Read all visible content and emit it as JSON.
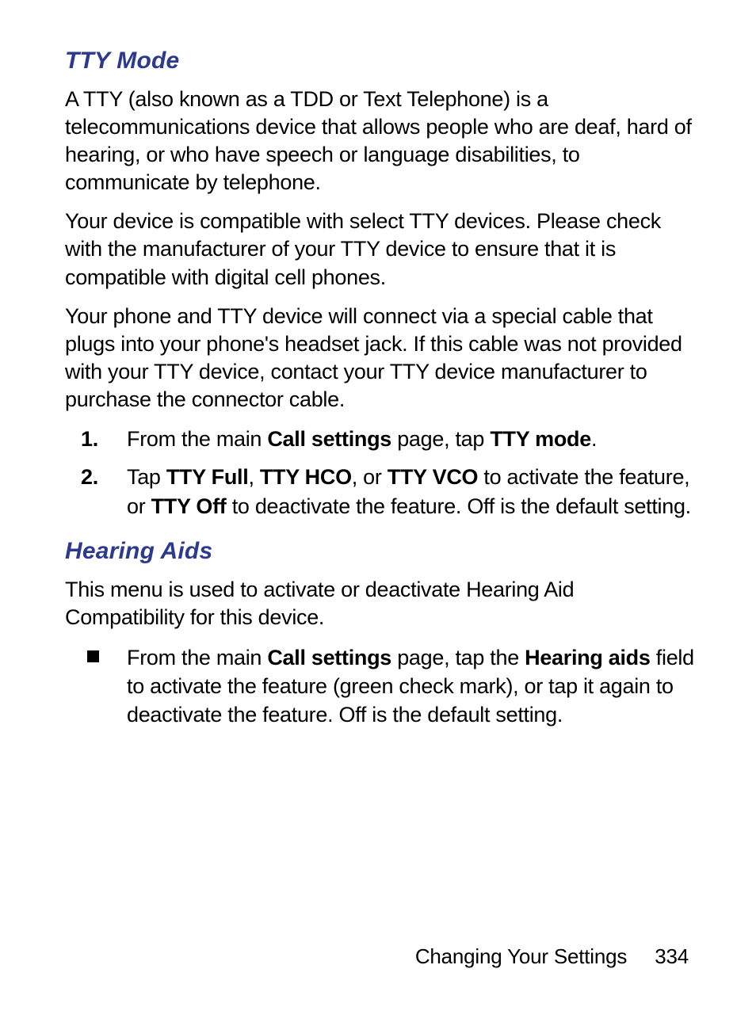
{
  "sections": [
    {
      "heading": "TTY Mode",
      "paragraphs": [
        "A TTY (also known as a TDD or Text Telephone) is a telecommunications device that allows people who are deaf, hard of hearing, or who have speech or language disabilities, to communicate by telephone.",
        "Your device is compatible with select TTY devices. Please check with the manufacturer of your TTY device to ensure that it is compatible with digital cell phones.",
        "Your phone and TTY device will connect via a special cable that plugs into your phone's headset jack. If this cable was not provided with your TTY device, contact your TTY device manufacturer to purchase the connector cable."
      ],
      "ordered_steps": [
        {
          "parts": [
            {
              "t": "From the main ",
              "b": false
            },
            {
              "t": "Call settings",
              "b": true
            },
            {
              "t": " page, tap ",
              "b": false
            },
            {
              "t": "TTY mode",
              "b": true
            },
            {
              "t": ".",
              "b": false
            }
          ]
        },
        {
          "parts": [
            {
              "t": "Tap ",
              "b": false
            },
            {
              "t": "TTY Full",
              "b": true
            },
            {
              "t": ", ",
              "b": false
            },
            {
              "t": "TTY HCO",
              "b": true
            },
            {
              "t": ", or ",
              "b": false
            },
            {
              "t": "TTY VCO",
              "b": true
            },
            {
              "t": " to activate the feature, or ",
              "b": false
            },
            {
              "t": "TTY Off",
              "b": true
            },
            {
              "t": " to deactivate the feature. Off is the default setting.",
              "b": false
            }
          ]
        }
      ]
    },
    {
      "heading": "Hearing Aids",
      "paragraphs": [
        "This menu is used to activate or deactivate Hearing Aid Compatibility for this device."
      ],
      "bullets": [
        {
          "parts": [
            {
              "t": "From the main ",
              "b": false
            },
            {
              "t": "Call settings",
              "b": true
            },
            {
              "t": " page, tap the ",
              "b": false
            },
            {
              "t": "Hearing aids",
              "b": true
            },
            {
              "t": " field to activate the feature (green check mark), or tap it again to deactivate the feature. Off is the default setting.",
              "b": false
            }
          ]
        }
      ]
    }
  ],
  "footer": {
    "chapter": "Changing Your Settings",
    "page_number": "334"
  }
}
